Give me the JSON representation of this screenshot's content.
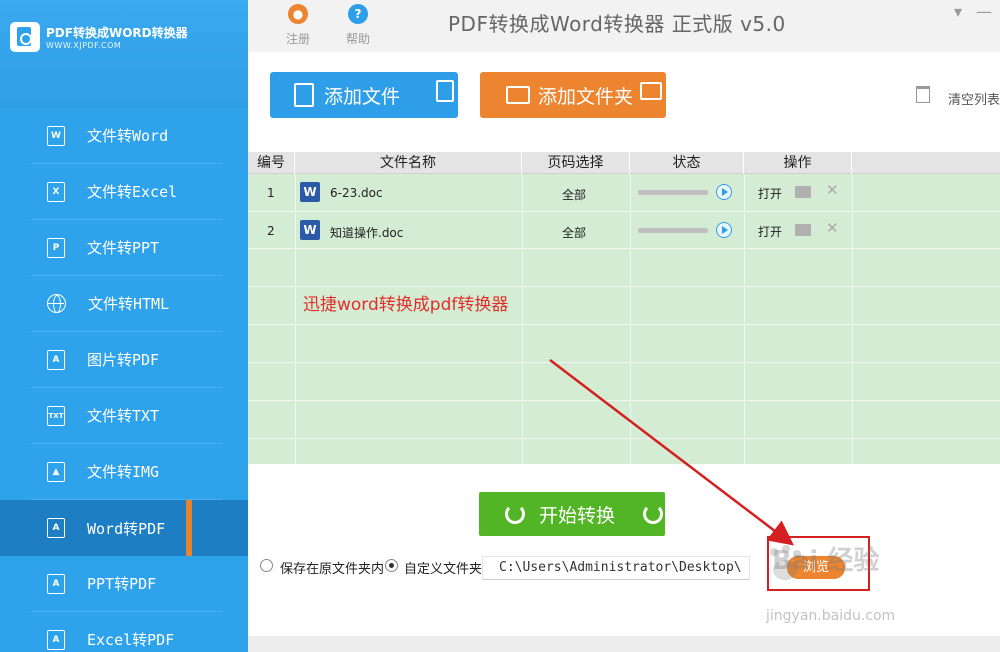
{
  "app": {
    "logo_title": "PDF转换成WORD转换器",
    "logo_sub": "WWW.XJPDF.COM",
    "window_title": "PDF转换成Word转换器 正式版 v5.0"
  },
  "toolbar": {
    "register_label": "注册",
    "help_label": "帮助",
    "register_icon": "user-icon",
    "help_icon": "question-icon"
  },
  "sidebar": {
    "items": [
      {
        "label": "文件转Word",
        "icon": "W",
        "active": false
      },
      {
        "label": "文件转Excel",
        "icon": "X",
        "active": false
      },
      {
        "label": "文件转PPT",
        "icon": "P",
        "active": false
      },
      {
        "label": "文件转HTML",
        "icon": "globe",
        "active": false
      },
      {
        "label": "图片转PDF",
        "icon": "pdf",
        "active": false
      },
      {
        "label": "文件转TXT",
        "icon": "TXT",
        "active": false
      },
      {
        "label": "文件转IMG",
        "icon": "img",
        "active": false
      },
      {
        "label": "Word转PDF",
        "icon": "pdf",
        "active": true
      },
      {
        "label": "PPT转PDF",
        "icon": "pdf",
        "active": false
      },
      {
        "label": "Excel转PDF",
        "icon": "pdf",
        "active": false
      }
    ]
  },
  "actions": {
    "add_file_label": "添加文件",
    "add_folder_label": "添加文件夹",
    "clear_list_label": "清空列表"
  },
  "table": {
    "headers": [
      "编号",
      "文件名称",
      "页码选择",
      "状态",
      "操作"
    ],
    "rows": [
      {
        "index": "1",
        "filename": "6-23.doc",
        "pages": "全部",
        "open_label": "打开"
      },
      {
        "index": "2",
        "filename": "知道操作.doc",
        "pages": "全部",
        "open_label": "打开"
      }
    ]
  },
  "annotation": {
    "text": "迅捷word转换成pdf转换器"
  },
  "convert": {
    "start_label": "开始转换"
  },
  "save": {
    "option_original": "保存在原文件夹内",
    "option_custom": "自定义文件夹",
    "path_value": "C:\\Users\\Administrator\\Desktop\\",
    "browse_label": "浏览"
  },
  "watermark": {
    "brand": "Bai 经验",
    "url": "jingyan.baidu.com"
  },
  "colors": {
    "sidebar": "#2ea3ec",
    "sidebar_active": "#1d7ec4",
    "active_marker": "#e8832c",
    "add_file": "#2e9ee8",
    "add_folder": "#ec8430",
    "start": "#52b526",
    "table_bg": "#d4ecd4",
    "annotation": "#e0302a"
  }
}
